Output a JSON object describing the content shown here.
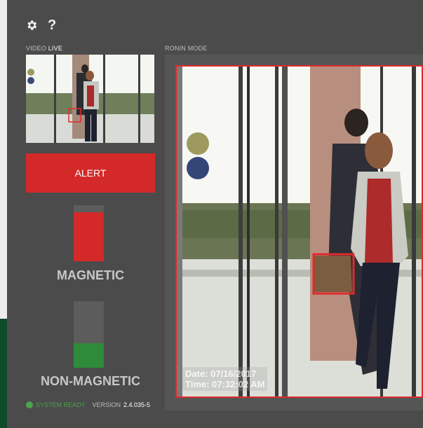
{
  "toolbar": {
    "settings_icon": "gear-icon",
    "help_label": "?"
  },
  "video": {
    "label": "VIDEO",
    "live_label": "LIVE"
  },
  "main": {
    "mode_label": "RONIN MODE",
    "date_text": "Date: 07/16/2017",
    "time_text": "Time: 07:32:02 AM"
  },
  "alert": {
    "label": "ALERT",
    "color": "#d42929"
  },
  "magnetic": {
    "label": "MAGNETIC",
    "level": 0.87,
    "color": "#d42929"
  },
  "non_magnetic": {
    "label": "NON-MAGNETIC",
    "level": 0.37,
    "color": "#2e8b3a"
  },
  "status": {
    "text": "SYSTEM READY",
    "version_label": "VERSION",
    "version_value": "2.4.035-5",
    "color": "#4aa64a"
  }
}
